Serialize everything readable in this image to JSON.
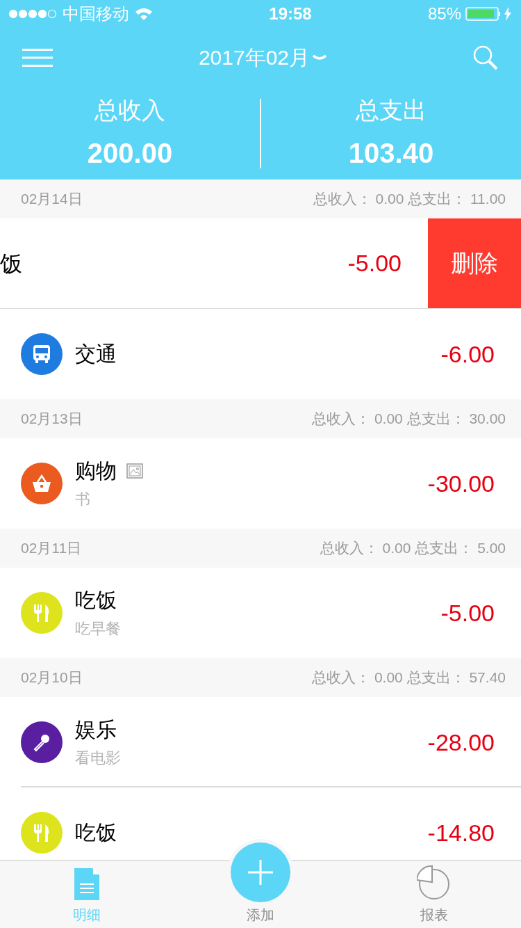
{
  "status_bar": {
    "carrier": "中国移动",
    "time": "19:58",
    "battery": "85%"
  },
  "header": {
    "month": "2017年02月"
  },
  "totals": [
    {
      "label": "总收入",
      "value": "200.00"
    },
    {
      "label": "总支出",
      "value": "103.40"
    }
  ],
  "days": [
    {
      "date": "02月14日",
      "summary": "总收入： 0.00 总支出： 11.00",
      "entries": [
        {
          "swiped": true,
          "title": "饭",
          "amount": "-5.00",
          "delete_label": "删除"
        },
        {
          "swiped": false,
          "kind": "bus",
          "color": "#1e7be0",
          "title": "交通",
          "amount": "-6.00"
        }
      ]
    },
    {
      "date": "02月13日",
      "summary": "总收入： 0.00 总支出： 30.00",
      "entries": [
        {
          "swiped": false,
          "kind": "basket",
          "color": "#eb5a1e",
          "title": "购物",
          "has_image": true,
          "note": "书",
          "amount": "-30.00"
        }
      ]
    },
    {
      "date": "02月11日",
      "summary": "总收入： 0.00 总支出： 5.00",
      "entries": [
        {
          "swiped": false,
          "kind": "food",
          "color": "#dde41e",
          "title": "吃饭",
          "note": "吃早餐",
          "amount": "-5.00"
        }
      ]
    },
    {
      "date": "02月10日",
      "summary": "总收入： 0.00 总支出： 57.40",
      "entries": [
        {
          "swiped": false,
          "kind": "mic",
          "color": "#5a1ea0",
          "title": "娱乐",
          "note": "看电影",
          "amount": "-28.00"
        },
        {
          "swiped": false,
          "kind": "food",
          "color": "#dde41e",
          "title": "吃饭",
          "amount": "-14.80"
        }
      ]
    }
  ],
  "tabs": [
    {
      "kind": "list",
      "label": "明细",
      "selected": true
    },
    {
      "kind": "add",
      "label": "添加",
      "selected": false
    },
    {
      "kind": "chart",
      "label": "报表",
      "selected": false
    }
  ]
}
